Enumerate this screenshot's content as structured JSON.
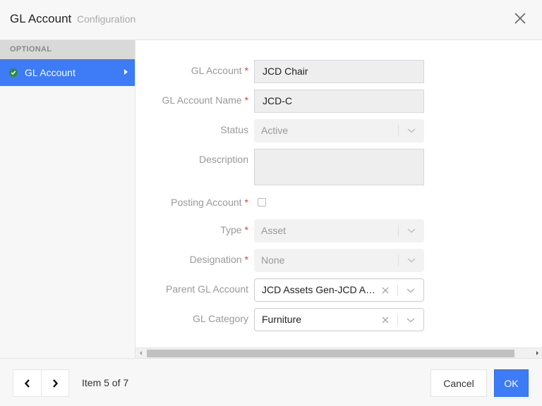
{
  "header": {
    "title": "GL Account",
    "subtitle": "Configuration"
  },
  "sidebar": {
    "section_label": "OPTIONAL",
    "items": [
      {
        "label": "GL Account",
        "status": "complete",
        "active": true
      }
    ]
  },
  "form": {
    "gl_account": {
      "label": "GL Account",
      "required": "*",
      "value": "JCD Chair"
    },
    "gl_account_name": {
      "label": "GL Account Name",
      "required": "*",
      "value": "JCD-C"
    },
    "status": {
      "label": "Status",
      "value": "Active"
    },
    "description": {
      "label": "Description",
      "value": ""
    },
    "posting_account": {
      "label": "Posting Account",
      "required": "*",
      "checked": false
    },
    "type": {
      "label": "Type",
      "required": "*",
      "value": "Asset"
    },
    "designation": {
      "label": "Designation",
      "required": "*",
      "value": "None"
    },
    "parent_gl_account": {
      "label": "Parent GL Account",
      "value": "JCD Assets Gen-JCD Ass..."
    },
    "gl_category": {
      "label": "GL Category",
      "value": "Furniture"
    }
  },
  "footer": {
    "pager_text": "Item 5 of 7",
    "cancel_label": "Cancel",
    "ok_label": "OK"
  },
  "colors": {
    "accent": "#3d7bf7",
    "required": "#e03c3c",
    "success": "#2e8b3e"
  }
}
